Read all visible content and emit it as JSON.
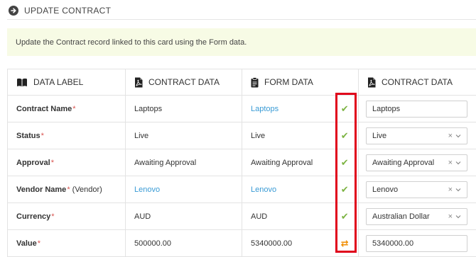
{
  "header": {
    "title": "UPDATE CONTRACT"
  },
  "notice": "Update the Contract record linked to this card using the Form data.",
  "columns": {
    "data_label": "DATA LABEL",
    "contract_data": "CONTRACT DATA",
    "form_data": "FORM DATA",
    "contract_data_edit": "CONTRACT DATA"
  },
  "rows": [
    {
      "label": "Contract Name",
      "required": "*",
      "suffix": "",
      "contract": "Laptops",
      "form": "Laptops",
      "status": "match",
      "input": "Laptops"
    },
    {
      "label": "Status",
      "required": "*",
      "suffix": "",
      "contract": "Live",
      "form": "Live",
      "status": "match",
      "input": "Live"
    },
    {
      "label": "Approval",
      "required": "*",
      "suffix": "",
      "contract": "Awaiting Approval",
      "form": "Awaiting Approval",
      "status": "match",
      "input": "Awaiting Approval"
    },
    {
      "label": "Vendor Name",
      "required": "*",
      "suffix": "(Vendor)",
      "contract": "Lenovo",
      "form": "Lenovo",
      "status": "match",
      "input": "Lenovo"
    },
    {
      "label": "Currency",
      "required": "*",
      "suffix": "",
      "contract": "AUD",
      "form": "AUD",
      "status": "match",
      "input": "Australian Dollar"
    },
    {
      "label": "Value",
      "required": "*",
      "suffix": "",
      "contract": "500000.00",
      "form": "5340000.00",
      "status": "different",
      "input": "5340000.00"
    }
  ],
  "icons": {
    "back": "arrow-circle-icon",
    "match": "check-icon",
    "different": "swap-icon",
    "clear": "×",
    "dropdown": "chevron-down-icon"
  },
  "colors": {
    "notice_bg": "#f7fbe5",
    "match": "#7cb342",
    "different": "#f08c00",
    "link": "#3a9bd5",
    "required": "#d9534f",
    "highlight": "#e0001b"
  }
}
